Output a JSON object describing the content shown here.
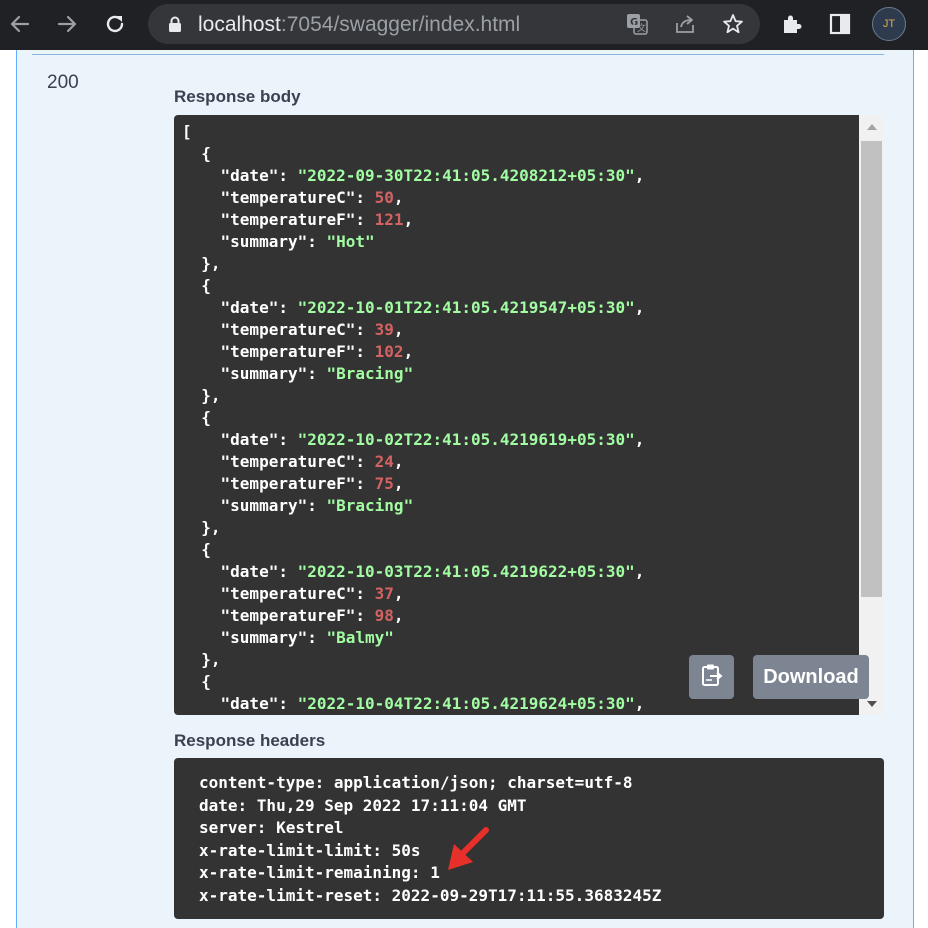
{
  "browser": {
    "url_host": "localhost",
    "url_path": ":7054/swagger/index.html",
    "profile_initials": "JT",
    "icons": [
      "back-icon",
      "forward-icon",
      "reload-icon",
      "lock-icon",
      "translate-icon",
      "share-icon",
      "star-icon",
      "extensions-icon",
      "side-panel-icon"
    ]
  },
  "response": {
    "status_code": "200",
    "body_label": "Response body",
    "body_lines": [
      [
        {
          "t": "p",
          "v": "["
        }
      ],
      [
        {
          "t": "p",
          "v": "  {"
        }
      ],
      [
        {
          "t": "p",
          "v": "    "
        },
        {
          "t": "k",
          "v": "\"date\""
        },
        {
          "t": "p",
          "v": ": "
        },
        {
          "t": "s",
          "v": "\"2022-09-30T22:41:05.4208212+05:30\""
        },
        {
          "t": "p",
          "v": ","
        }
      ],
      [
        {
          "t": "p",
          "v": "    "
        },
        {
          "t": "k",
          "v": "\"temperatureC\""
        },
        {
          "t": "p",
          "v": ": "
        },
        {
          "t": "n",
          "v": "50"
        },
        {
          "t": "p",
          "v": ","
        }
      ],
      [
        {
          "t": "p",
          "v": "    "
        },
        {
          "t": "k",
          "v": "\"temperatureF\""
        },
        {
          "t": "p",
          "v": ": "
        },
        {
          "t": "n",
          "v": "121"
        },
        {
          "t": "p",
          "v": ","
        }
      ],
      [
        {
          "t": "p",
          "v": "    "
        },
        {
          "t": "k",
          "v": "\"summary\""
        },
        {
          "t": "p",
          "v": ": "
        },
        {
          "t": "s",
          "v": "\"Hot\""
        }
      ],
      [
        {
          "t": "p",
          "v": "  },"
        }
      ],
      [
        {
          "t": "p",
          "v": "  {"
        }
      ],
      [
        {
          "t": "p",
          "v": "    "
        },
        {
          "t": "k",
          "v": "\"date\""
        },
        {
          "t": "p",
          "v": ": "
        },
        {
          "t": "s",
          "v": "\"2022-10-01T22:41:05.4219547+05:30\""
        },
        {
          "t": "p",
          "v": ","
        }
      ],
      [
        {
          "t": "p",
          "v": "    "
        },
        {
          "t": "k",
          "v": "\"temperatureC\""
        },
        {
          "t": "p",
          "v": ": "
        },
        {
          "t": "n",
          "v": "39"
        },
        {
          "t": "p",
          "v": ","
        }
      ],
      [
        {
          "t": "p",
          "v": "    "
        },
        {
          "t": "k",
          "v": "\"temperatureF\""
        },
        {
          "t": "p",
          "v": ": "
        },
        {
          "t": "n",
          "v": "102"
        },
        {
          "t": "p",
          "v": ","
        }
      ],
      [
        {
          "t": "p",
          "v": "    "
        },
        {
          "t": "k",
          "v": "\"summary\""
        },
        {
          "t": "p",
          "v": ": "
        },
        {
          "t": "s",
          "v": "\"Bracing\""
        }
      ],
      [
        {
          "t": "p",
          "v": "  },"
        }
      ],
      [
        {
          "t": "p",
          "v": "  {"
        }
      ],
      [
        {
          "t": "p",
          "v": "    "
        },
        {
          "t": "k",
          "v": "\"date\""
        },
        {
          "t": "p",
          "v": ": "
        },
        {
          "t": "s",
          "v": "\"2022-10-02T22:41:05.4219619+05:30\""
        },
        {
          "t": "p",
          "v": ","
        }
      ],
      [
        {
          "t": "p",
          "v": "    "
        },
        {
          "t": "k",
          "v": "\"temperatureC\""
        },
        {
          "t": "p",
          "v": ": "
        },
        {
          "t": "n",
          "v": "24"
        },
        {
          "t": "p",
          "v": ","
        }
      ],
      [
        {
          "t": "p",
          "v": "    "
        },
        {
          "t": "k",
          "v": "\"temperatureF\""
        },
        {
          "t": "p",
          "v": ": "
        },
        {
          "t": "n",
          "v": "75"
        },
        {
          "t": "p",
          "v": ","
        }
      ],
      [
        {
          "t": "p",
          "v": "    "
        },
        {
          "t": "k",
          "v": "\"summary\""
        },
        {
          "t": "p",
          "v": ": "
        },
        {
          "t": "s",
          "v": "\"Bracing\""
        }
      ],
      [
        {
          "t": "p",
          "v": "  },"
        }
      ],
      [
        {
          "t": "p",
          "v": "  {"
        }
      ],
      [
        {
          "t": "p",
          "v": "    "
        },
        {
          "t": "k",
          "v": "\"date\""
        },
        {
          "t": "p",
          "v": ": "
        },
        {
          "t": "s",
          "v": "\"2022-10-03T22:41:05.4219622+05:30\""
        },
        {
          "t": "p",
          "v": ","
        }
      ],
      [
        {
          "t": "p",
          "v": "    "
        },
        {
          "t": "k",
          "v": "\"temperatureC\""
        },
        {
          "t": "p",
          "v": ": "
        },
        {
          "t": "n",
          "v": "37"
        },
        {
          "t": "p",
          "v": ","
        }
      ],
      [
        {
          "t": "p",
          "v": "    "
        },
        {
          "t": "k",
          "v": "\"temperatureF\""
        },
        {
          "t": "p",
          "v": ": "
        },
        {
          "t": "n",
          "v": "98"
        },
        {
          "t": "p",
          "v": ","
        }
      ],
      [
        {
          "t": "p",
          "v": "    "
        },
        {
          "t": "k",
          "v": "\"summary\""
        },
        {
          "t": "p",
          "v": ": "
        },
        {
          "t": "s",
          "v": "\"Balmy\""
        }
      ],
      [
        {
          "t": "p",
          "v": "  },"
        }
      ],
      [
        {
          "t": "p",
          "v": "  {"
        }
      ],
      [
        {
          "t": "p",
          "v": "    "
        },
        {
          "t": "k",
          "v": "\"date\""
        },
        {
          "t": "p",
          "v": ": "
        },
        {
          "t": "s",
          "v": "\"2022-10-04T22:41:05.4219624+05:30\""
        },
        {
          "t": "p",
          "v": ","
        }
      ]
    ],
    "download_label": "Download",
    "headers_label": "Response headers",
    "header_lines": [
      "content-type: application/json; charset=utf-8",
      "date: Thu,29 Sep 2022 17:11:04 GMT",
      "server: Kestrel",
      "x-rate-limit-limit: 50s",
      "x-rate-limit-remaining: 1",
      "x-rate-limit-reset: 2022-09-29T17:11:55.3683245Z"
    ]
  },
  "colors": {
    "chrome_bg": "#202124",
    "code_bg": "#333333",
    "json_string": "#a2fca2",
    "json_number": "#d36363",
    "panel_bg": "#ebf3fb",
    "annotation_arrow": "#e8302a"
  }
}
